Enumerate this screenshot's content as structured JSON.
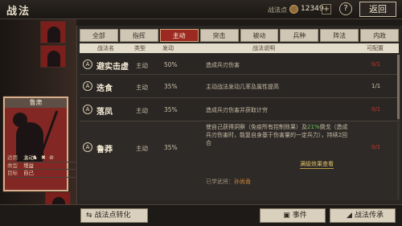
{
  "header": {
    "title": "战法",
    "points_label": "战法点",
    "points_value": "12349",
    "plus": "+",
    "help": "?",
    "back": "返回"
  },
  "card": {
    "name": "鲁肃",
    "info": [
      {
        "k": "适用",
        "v": "主动"
      },
      {
        "k": "类型",
        "v": "增益"
      },
      {
        "k": "目标",
        "v": "自己"
      }
    ],
    "icons": "⚔ ♞ ✖ ⊘"
  },
  "tabs": [
    "全部",
    "指挥",
    "主动",
    "突击",
    "被动",
    "兵种",
    "阵法",
    "内政"
  ],
  "active_tab": 2,
  "columns": [
    "战法名",
    "类型",
    "发动",
    "战法说明",
    "可配置"
  ],
  "rows": [
    {
      "badge": "A",
      "name": "避实击虚",
      "type": "主动",
      "rate": "50%",
      "desc": "造成兵刃伤害",
      "cfg": "0/1",
      "cfg_ok": false
    },
    {
      "badge": "A",
      "name": "迭食",
      "type": "主动",
      "rate": "35%",
      "desc": "主动战法发动几率及属性提高",
      "cfg": "1/1",
      "cfg_ok": true
    },
    {
      "badge": "A",
      "name": "落凤",
      "type": "主动",
      "rate": "35%",
      "desc": "造成兵刃伤害并获取计穷",
      "cfg": "0/1",
      "cfg_ok": false
    },
    {
      "badge": "A",
      "name": "鲁莽",
      "type": "主动",
      "rate": "35%",
      "desc_pre": "使自己获得洞察（免疫所有控制效果）及",
      "desc_hl": "21%",
      "desc_post": "倒戈（造成兵刃伤害时，能复自身基于伤害量的一定兵力），持续2回合",
      "more": "满级效果查看",
      "owned_label": "已学武将：",
      "owned_who": "孙尚香",
      "cfg": "0/1",
      "cfg_ok": false
    }
  ],
  "buttons": {
    "convert": "战法点转化",
    "event": "事件",
    "inherit": "战法传承"
  }
}
